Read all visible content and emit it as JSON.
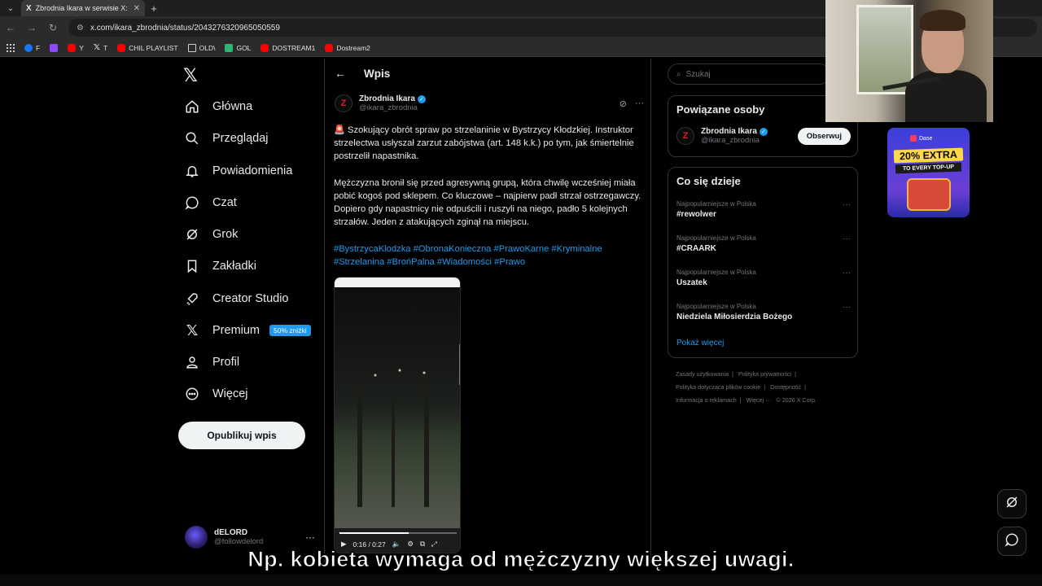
{
  "browser": {
    "tab_title": "Zbrodnia Ikara w serwisie X: „🚨",
    "tab_icon": "X",
    "url": "x.com/ikara_zbrodnia/status/2043276320965050559",
    "bookmarks": [
      {
        "label": "F",
        "icon": "facebook-icon"
      },
      {
        "label": "",
        "icon": "twitch-icon"
      },
      {
        "label": "Y",
        "icon": "youtube-icon"
      },
      {
        "label": "T",
        "icon": "x-icon"
      },
      {
        "label": "CHIL PLAYLIST",
        "icon": "youtube-icon"
      },
      {
        "label": "OLD\\",
        "icon": "folder-icon"
      },
      {
        "label": "GOL",
        "icon": "gol-icon"
      },
      {
        "label": "DOSTREAM1",
        "icon": "youtube-icon"
      },
      {
        "label": "Dostream2",
        "icon": "youtube-icon"
      }
    ]
  },
  "nav": {
    "items": [
      {
        "label": "Główna",
        "icon": "home-icon"
      },
      {
        "label": "Przeglądaj",
        "icon": "search-icon"
      },
      {
        "label": "Powiadomienia",
        "icon": "bell-icon"
      },
      {
        "label": "Czat",
        "icon": "chat-icon"
      },
      {
        "label": "Grok",
        "icon": "grok-icon"
      },
      {
        "label": "Zakładki",
        "icon": "bookmark-icon"
      },
      {
        "label": "Creator Studio",
        "icon": "rocket-icon"
      },
      {
        "label": "Premium",
        "icon": "x-icon",
        "badge": "50% zniżki"
      },
      {
        "label": "Profil",
        "icon": "person-icon"
      },
      {
        "label": "Więcej",
        "icon": "more-circle-icon"
      }
    ],
    "post_button": "Opublikuj wpis",
    "user": {
      "name": "dELORD",
      "handle": "@followdelord"
    }
  },
  "post": {
    "header": "Wpis",
    "author_name": "Zbrodnia Ikara",
    "author_handle": "@ikara_zbrodnia",
    "paragraph1": "🚨 Szokujący obrót spraw po strzelaninie w Bystrzycy Kłodzkiej. Instruktor strzelectwa usłyszał zarzut zabójstwa (art. 148 k.k.) po tym, jak śmiertelnie postrzelił napastnika.",
    "paragraph2": "Mężczyzna bronił się przed agresywną grupą, która chwilę wcześniej miała pobić kogoś pod sklepem. Co kluczowe – najpierw padł strzał ostrzegawczy. Dopiero gdy napastnicy nie odpuścili i ruszyli na niego, padło 5 kolejnych strzałów. Jeden z atakujących zginął na miejscu.",
    "hashtags": "#BystrzycaKlodzka #ObronaKonieczna #PrawoKarne #Kryminalne #Strzelanina #BrońPalna #Wiadomości #Prawo",
    "video": {
      "time": "0:16 / 0:27",
      "progress": 0.59
    }
  },
  "sidebar": {
    "search_placeholder": "Szukaj",
    "related_title": "Powiązane osoby",
    "related_person": {
      "name": "Zbrodnia Ikara",
      "handle": "@ikara_zbrodnia",
      "follow_label": "Obserwuj"
    },
    "trends_title": "Co się dzieje",
    "trends": [
      {
        "meta": "Najpopularniejsze w Polska",
        "name": "#rewolwer"
      },
      {
        "meta": "Najpopularniejsze w Polska",
        "name": "#CRAARK"
      },
      {
        "meta": "Najpopularniejsze w Polska",
        "name": "Uszatek"
      },
      {
        "meta": "Najpopularniejsze w Polska",
        "name": "Niedziela Miłosierdzia Bożego"
      }
    ],
    "show_more": "Pokaż więcej",
    "footer": {
      "l1": "Zasady użytkowania",
      "l2": "Polityka prywatności",
      "l3": "Polityka dotycząca plików cookie",
      "l4": "Dostępność",
      "l5": "Informacja o reklamach",
      "l6": "Więcej ···",
      "l7": "© 2026 X Corp."
    }
  },
  "ad": {
    "brand": "Dase",
    "headline": "20% EXTRA",
    "subline": "TO EVERY TOP-UP"
  },
  "subtitle": "Np. kobieta wymaga od mężczyzny większej uwagi.",
  "colors": {
    "accent": "#1d9bf0",
    "background": "#000000",
    "border": "#2f3336"
  }
}
